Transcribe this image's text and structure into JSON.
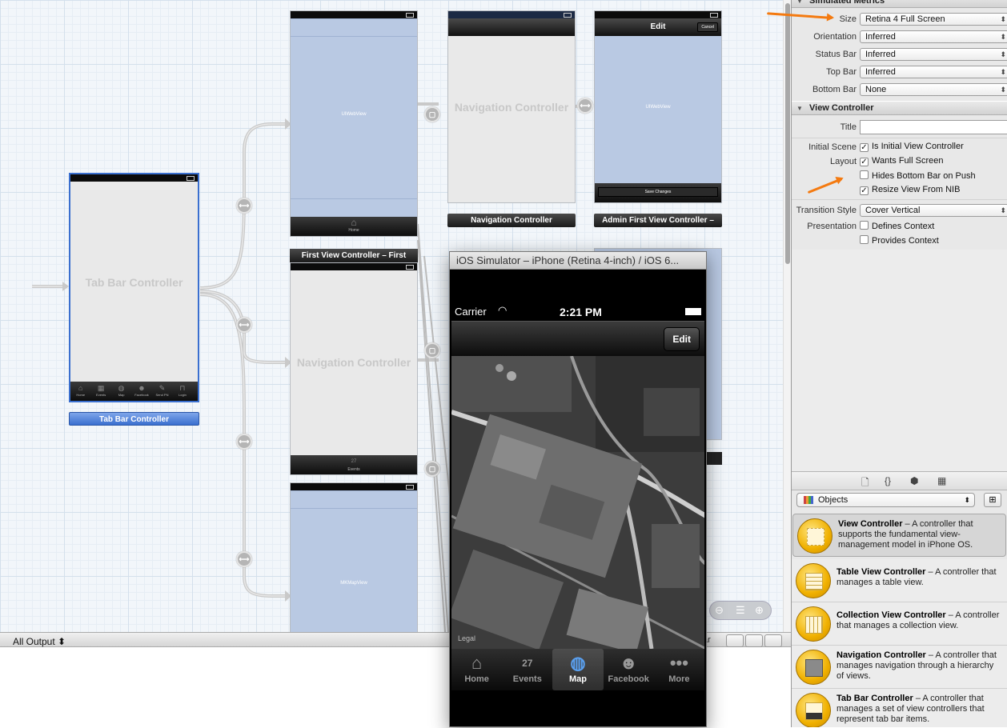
{
  "storyboard": {
    "tab_bar_controller": {
      "title": "Tab Bar Controller",
      "label": "Tab Bar Controller",
      "tabs": [
        "Home",
        "Events",
        "Map",
        "Facebook",
        "Send PN",
        "Login"
      ]
    },
    "scene_webview_top": {
      "title": "UIWebView",
      "tab": "Home"
    },
    "scene_nav_top": {
      "title": "Navigation Controller",
      "label": "Navigation Controller"
    },
    "scene_admin": {
      "nav_title": "Edit",
      "cancel": "Cancel",
      "title": "UIWebView",
      "save": "Save Changes",
      "label": "Admin First View Controller –"
    },
    "scene_nav_mid": {
      "header": "First View Controller – First",
      "title": "Navigation Controller",
      "tab": "Events",
      "tab_day": "27"
    },
    "scene_map": {
      "title": "MKMapView"
    }
  },
  "simulator": {
    "window_title": "iOS Simulator – iPhone (Retina 4-inch) / iOS 6...",
    "carrier": "Carrier",
    "time": "2:21 PM",
    "edit_button": "Edit",
    "map_legal": "Legal",
    "events_day": "27",
    "tabs": [
      {
        "label": "Home",
        "icon": "house-icon"
      },
      {
        "label": "Events",
        "icon": "calendar-icon"
      },
      {
        "label": "Map",
        "icon": "globe-icon"
      },
      {
        "label": "Facebook",
        "icon": "people-icon"
      },
      {
        "label": "More",
        "icon": "more-icon"
      }
    ],
    "active_tab": "Map"
  },
  "console": {
    "output_label": "All Output ⬍",
    "bar_fragment": "ar"
  },
  "inspector": {
    "simulated_metrics": {
      "header": "Simulated Metrics",
      "size_label": "Size",
      "size_value": "Retina 4 Full Screen",
      "orientation_label": "Orientation",
      "orientation_value": "Inferred",
      "status_bar_label": "Status Bar",
      "status_bar_value": "Inferred",
      "top_bar_label": "Top Bar",
      "top_bar_value": "Inferred",
      "bottom_bar_label": "Bottom Bar",
      "bottom_bar_value": "None"
    },
    "view_controller": {
      "header": "View Controller",
      "title_label": "Title",
      "title_value": "",
      "initial_scene_label": "Initial Scene",
      "is_initial": "Is Initial View Controller",
      "layout_label": "Layout",
      "wants_full_screen": "Wants Full Screen",
      "hides_bottom_bar": "Hides Bottom Bar on Push",
      "resize_view": "Resize View From NIB",
      "transition_style_label": "Transition Style",
      "transition_style_value": "Cover Vertical",
      "presentation_label": "Presentation",
      "defines_context": "Defines Context",
      "provides_context": "Provides Context"
    },
    "library": {
      "selector": "Objects",
      "items": [
        {
          "name": "View Controller",
          "desc": " – A controller that supports the fundamental view-management model in iPhone OS."
        },
        {
          "name": "Table View Controller",
          "desc": " – A controller that manages a table view."
        },
        {
          "name": "Collection View Controller",
          "desc": " – A controller that manages a collection view."
        },
        {
          "name": "Navigation Controller",
          "desc": " – A controller that manages navigation through a hierarchy of views."
        },
        {
          "name": "Tab Bar Controller",
          "desc": " – A controller that manages a set of view controllers that represent tab bar items."
        }
      ]
    }
  },
  "colors": {
    "accent": "#3a6fcf",
    "annotation": "#f47a10",
    "webview": "#b9c9e3"
  }
}
